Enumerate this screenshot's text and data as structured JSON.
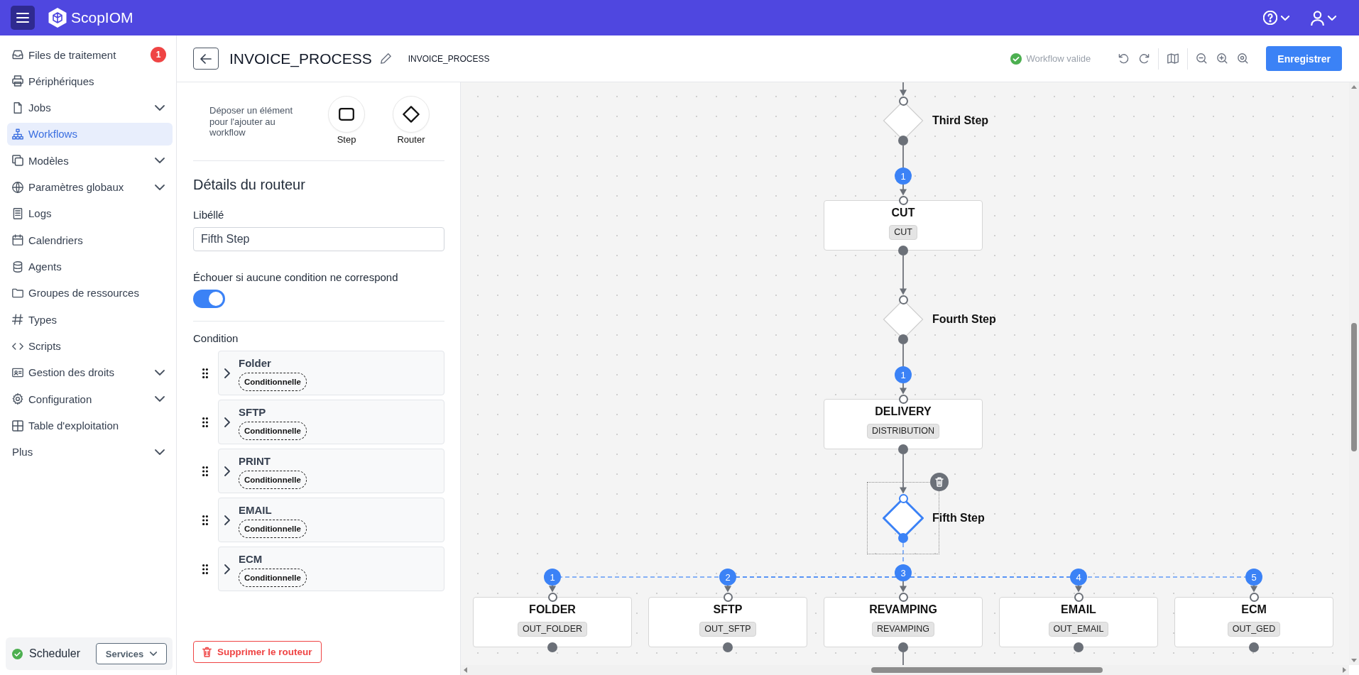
{
  "topbar": {
    "brand": "ScopIOM"
  },
  "sidebar": {
    "items": [
      {
        "label": "Files de traitement",
        "kind": "link",
        "selected": false,
        "badge": "1"
      },
      {
        "label": "Périphériques",
        "kind": "link",
        "selected": false
      },
      {
        "label": "Jobs",
        "kind": "group",
        "selected": false,
        "expanded": false
      },
      {
        "label": "Workflows",
        "kind": "link",
        "selected": true
      },
      {
        "label": "Modèles",
        "kind": "group",
        "selected": false,
        "expanded": false
      },
      {
        "label": "Paramètres globaux",
        "kind": "group",
        "selected": false,
        "expanded": false
      },
      {
        "label": "Logs",
        "kind": "link",
        "selected": false
      },
      {
        "label": "Calendriers",
        "kind": "link",
        "selected": false
      },
      {
        "label": "Agents",
        "kind": "link",
        "selected": false
      },
      {
        "label": "Groupes de ressources",
        "kind": "link",
        "selected": false
      },
      {
        "label": "Types",
        "kind": "link",
        "selected": false
      },
      {
        "label": "Scripts",
        "kind": "link",
        "selected": false
      },
      {
        "label": "Gestion des droits",
        "kind": "group",
        "selected": false,
        "expanded": false
      },
      {
        "label": "Configuration",
        "kind": "group",
        "selected": false,
        "expanded": false
      },
      {
        "label": "Table d'exploitation",
        "kind": "link",
        "selected": false
      },
      {
        "label": "Plus",
        "kind": "group",
        "selected": false,
        "expanded": false
      }
    ],
    "scheduler": {
      "label": "Scheduler",
      "healthy": true,
      "button": "Services"
    }
  },
  "header": {
    "title": "INVOICE_PROCESS",
    "subtitle": "INVOICE_PROCESS",
    "validation": {
      "valid": true,
      "text": "Workflow valide"
    },
    "save_button": "Enregistrer"
  },
  "palette": {
    "hint": "Déposer un élément pour l'ajouter au workflow",
    "items": [
      {
        "kind": "step",
        "label": "Step"
      },
      {
        "kind": "router",
        "label": "Router"
      }
    ]
  },
  "details": {
    "heading": "Détails du routeur",
    "name_field": {
      "label": "Libéllé",
      "value": "Fifth Step"
    },
    "fail_toggle": {
      "label": "Échouer si aucune condition ne correspond",
      "on": true
    },
    "conditions_label": "Condition",
    "conditions": [
      {
        "name": "Folder",
        "tag": "Conditionnelle",
        "expanded": false
      },
      {
        "name": "SFTP",
        "tag": "Conditionnelle",
        "expanded": false
      },
      {
        "name": "PRINT",
        "tag": "Conditionnelle",
        "expanded": false
      },
      {
        "name": "EMAIL",
        "tag": "Conditionnelle",
        "expanded": false
      },
      {
        "name": "ECM",
        "tag": "Conditionnelle",
        "expanded": false
      }
    ],
    "delete_button": "Supprimer le routeur"
  },
  "canvas": {
    "chain": [
      {
        "kind": "router",
        "title": "Third Step",
        "selected": false
      },
      {
        "kind": "step",
        "title": "CUT",
        "tag": "CUT",
        "selected": false,
        "edge_label": "1"
      },
      {
        "kind": "router",
        "title": "Fourth Step",
        "selected": false
      },
      {
        "kind": "step",
        "title": "DELIVERY",
        "tag": "DISTRIBUTION",
        "selected": false,
        "edge_label": "1"
      },
      {
        "kind": "router",
        "title": "Fifth Step",
        "selected": true
      }
    ],
    "branches": [
      {
        "edge_label": "1",
        "title": "FOLDER",
        "tag": "OUT_FOLDER",
        "selected": false,
        "continues": false
      },
      {
        "edge_label": "2",
        "title": "SFTP",
        "tag": "OUT_SFTP",
        "selected": false,
        "continues": false
      },
      {
        "edge_label": "3",
        "title": "REVAMPING",
        "tag": "REVAMPING",
        "selected": false,
        "continues": true
      },
      {
        "edge_label": "4",
        "title": "EMAIL",
        "tag": "OUT_EMAIL",
        "selected": false,
        "continues": false
      },
      {
        "edge_label": "5",
        "title": "ECM",
        "tag": "OUT_GED",
        "selected": false,
        "continues": false
      }
    ]
  }
}
